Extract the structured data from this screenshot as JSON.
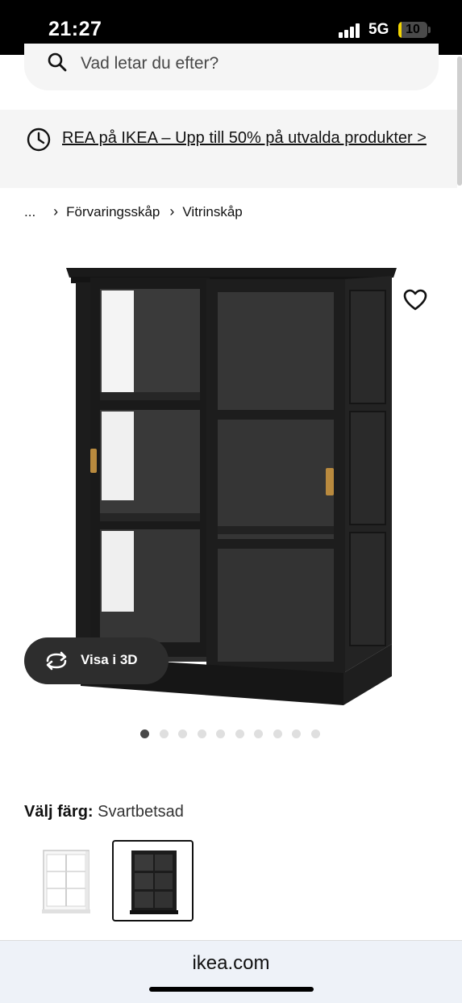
{
  "status_bar": {
    "time": "21:27",
    "network": "5G",
    "battery": "10",
    "battery_level": 0.1
  },
  "search": {
    "placeholder": "Vad letar du efter?",
    "icon": "search-icon"
  },
  "promo": {
    "text": "REA på IKEA – Upp till 50% på utvalda produkter >",
    "icon": "clock-icon"
  },
  "breadcrumb": {
    "ellipsis": "...",
    "sep": "›",
    "items": [
      "Förvaringsskåp",
      "Vitrinskåp"
    ]
  },
  "product": {
    "favorite_icon": "heart-outline-icon",
    "view_3d_label": "Visa i 3D",
    "image_count": 10,
    "active_image": 1
  },
  "color": {
    "label": "Välj färg:",
    "selected": "Svartbetsad",
    "options": [
      "white",
      "black-brown"
    ]
  },
  "browser": {
    "url": "ikea.com"
  },
  "colors": {
    "accent": "#111111",
    "panel": "#f5f5f5",
    "pill": "#2d2d2d",
    "cabinet": "#1c1c1c"
  }
}
